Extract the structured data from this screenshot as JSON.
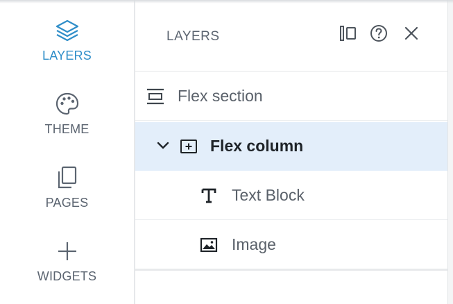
{
  "rail": {
    "items": [
      {
        "label": "LAYERS",
        "icon": "layers-icon",
        "active": true
      },
      {
        "label": "THEME",
        "icon": "palette-icon",
        "active": false
      },
      {
        "label": "PAGES",
        "icon": "pages-icon",
        "active": false
      },
      {
        "label": "WIDGETS",
        "icon": "plus-icon",
        "active": false
      }
    ]
  },
  "panel": {
    "title": "LAYERS",
    "header_icons": [
      "split-view-icon",
      "help-icon",
      "close-icon"
    ],
    "layers": [
      {
        "label": "Flex section",
        "icon": "flex-section-icon",
        "selected": false
      },
      {
        "label": "Flex column",
        "icon": "flex-column-icon",
        "selected": true,
        "expanded": true
      },
      {
        "label": "Text Block",
        "icon": "text-icon",
        "selected": false
      },
      {
        "label": "Image",
        "icon": "image-icon",
        "selected": false
      }
    ]
  },
  "colors": {
    "accent": "#2f8ec9",
    "selected_row": "#e3eefa",
    "muted_text": "#5b6470"
  }
}
